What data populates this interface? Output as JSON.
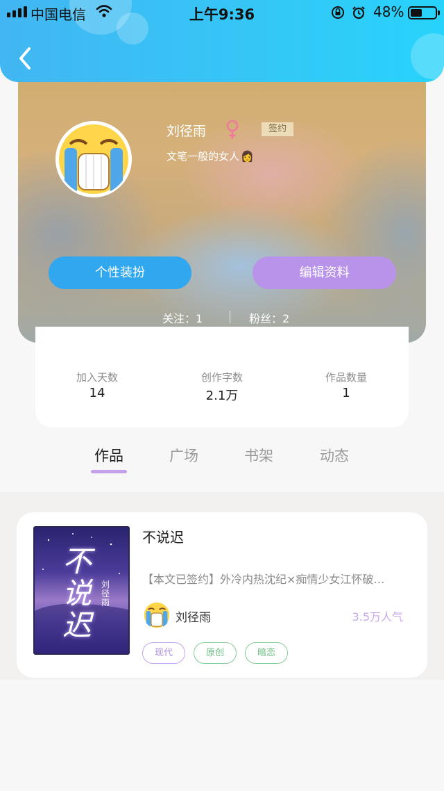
{
  "status_bar": {
    "carrier": "中国电信",
    "time": "上午9:36",
    "battery_percent": "48%",
    "battery_level": 0.48
  },
  "profile": {
    "username": "刘径雨",
    "gender_icon": "female-icon",
    "badge": "签约",
    "signature": "文笔一般的女人",
    "signature_emoji": "👩",
    "buttons": {
      "dress_up": "个性装扮",
      "edit_profile": "编辑资料"
    },
    "following": "关注：1",
    "followers": "粉丝：2"
  },
  "stats": [
    {
      "label": "加入天数",
      "value": "14"
    },
    {
      "label": "创作字数",
      "value": "2.1万"
    },
    {
      "label": "作品数量",
      "value": "1"
    }
  ],
  "tabs": [
    {
      "label": "作品",
      "active": true
    },
    {
      "label": "广场",
      "active": false
    },
    {
      "label": "书架",
      "active": false
    },
    {
      "label": "动态",
      "active": false
    }
  ],
  "book": {
    "cover_title": "不说迟",
    "cover_author": "刘径雨",
    "title": "不说迟",
    "description": "【本文已签约】外冷内热沈纪×痴情少女江怀破…",
    "author": "刘径雨",
    "popularity": "3.5万人气",
    "tags": [
      "现代",
      "原创",
      "暗恋"
    ]
  },
  "colors": {
    "header_blue": "#35c6f6",
    "button_blue": "#30a7ef",
    "button_purple": "#b993ea",
    "accent_purple": "#c4a0ea",
    "tag_green": "#6cbf82"
  }
}
